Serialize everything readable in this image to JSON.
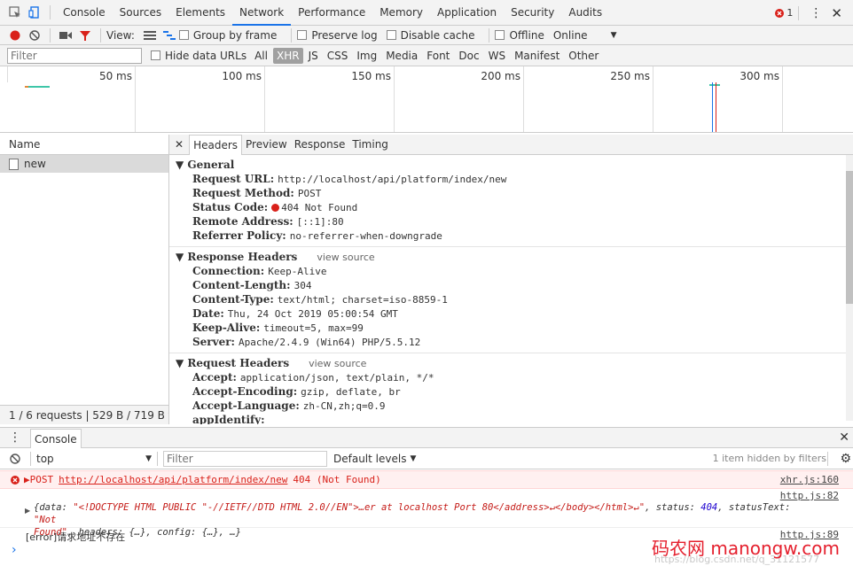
{
  "top_tabs": [
    "Console",
    "Sources",
    "Elements",
    "Network",
    "Performance",
    "Memory",
    "Application",
    "Security",
    "Audits"
  ],
  "active_tab": "Network",
  "error_count": "1",
  "toolbar": {
    "view_label": "View:",
    "group_by_frame": "Group by frame",
    "preserve_log": "Preserve log",
    "disable_cache": "Disable cache",
    "offline": "Offline",
    "throttle": "Online"
  },
  "filter": {
    "placeholder": "Filter",
    "hide_data_urls": "Hide data URLs",
    "types": [
      "All",
      "XHR",
      "JS",
      "CSS",
      "Img",
      "Media",
      "Font",
      "Doc",
      "WS",
      "Manifest",
      "Other"
    ],
    "active_type": "XHR"
  },
  "overview": {
    "ticks": [
      "50 ms",
      "100 ms",
      "150 ms",
      "200 ms",
      "250 ms",
      "300 ms"
    ]
  },
  "requests": {
    "header": "Name",
    "items": [
      "new"
    ],
    "status": "1 / 6 requests | 529 B / 719 B tran..."
  },
  "detail": {
    "tabs": [
      "Headers",
      "Preview",
      "Response",
      "Timing"
    ],
    "active_tab": "Headers",
    "general": {
      "title": "General",
      "rows": [
        {
          "k": "Request URL:",
          "v": "http://localhost/api/platform/index/new"
        },
        {
          "k": "Request Method:",
          "v": "POST"
        },
        {
          "k": "Status Code:",
          "v": "404 Not Found"
        },
        {
          "k": "Remote Address:",
          "v": "[::1]:80"
        },
        {
          "k": "Referrer Policy:",
          "v": "no-referrer-when-downgrade"
        }
      ]
    },
    "response_headers": {
      "title": "Response Headers",
      "view_source": "view source",
      "rows": [
        {
          "k": "Connection:",
          "v": "Keep-Alive"
        },
        {
          "k": "Content-Length:",
          "v": "304"
        },
        {
          "k": "Content-Type:",
          "v": "text/html; charset=iso-8859-1"
        },
        {
          "k": "Date:",
          "v": "Thu, 24 Oct 2019 05:00:54 GMT"
        },
        {
          "k": "Keep-Alive:",
          "v": "timeout=5, max=99"
        },
        {
          "k": "Server:",
          "v": "Apache/2.4.9 (Win64) PHP/5.5.12"
        }
      ]
    },
    "request_headers": {
      "title": "Request Headers",
      "view_source": "view source",
      "rows": [
        {
          "k": "Accept:",
          "v": "application/json, text/plain, */*"
        },
        {
          "k": "Accept-Encoding:",
          "v": "gzip, deflate, br"
        },
        {
          "k": "Accept-Language:",
          "v": "zh-CN,zh;q=0.9"
        },
        {
          "k": "appIdentify:",
          "v": ""
        }
      ]
    }
  },
  "drawer": {
    "tab": "Console",
    "context": "top",
    "filter_placeholder": "Filter",
    "levels": "Default levels",
    "hidden": "1 item hidden by filters"
  },
  "console": {
    "error_method": "POST",
    "error_url": "http://localhost/api/platform/index/new",
    "error_status": "404 (Not Found)",
    "error_src": "xhr.js:160",
    "obj_src": "http.js:82",
    "obj_line1_pre": "{data: ",
    "obj_line1_str": "\"<!DOCTYPE HTML PUBLIC \"-//IETF//DTD HTML 2.0//EN\">…er at localhost Port 80</address>↵</body></html>↵\"",
    "obj_line1_mid": ", status: ",
    "obj_status": "404",
    "obj_line1_post": ", statusText: ",
    "obj_status_text": "\"Not",
    "obj_line2_str": "Found\"",
    "obj_line2_post": ", headers: {…}, config: {…}, …}",
    "log_text": "[error]请求地址不存在",
    "log_src": "http.js:89",
    "prompt": "›"
  },
  "watermark": "码农网 manongw.com",
  "watermark_sub": "https://blog.csdn.net/q_31121577"
}
